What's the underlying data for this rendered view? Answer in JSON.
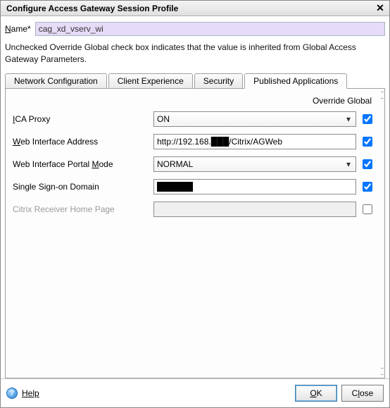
{
  "titlebar": {
    "title": "Configure Access Gateway Session Profile",
    "close_glyph": "✕"
  },
  "name_row": {
    "label_html": "Name*",
    "value": "cag_xd_vserv_wi"
  },
  "info_text": "Unchecked Override Global check box indicates that the value is inherited from Global Access Gateway Parameters.",
  "tabs": {
    "items": [
      {
        "label": "Network Configuration"
      },
      {
        "label": "Client Experience"
      },
      {
        "label": "Security"
      },
      {
        "label": "Published Applications"
      }
    ],
    "active_index": 3
  },
  "panel": {
    "override_header": "Override Global",
    "rows": [
      {
        "label": "ICA Proxy",
        "type": "select",
        "value": "ON",
        "checked": true,
        "disabled": false,
        "underline_idx": 0
      },
      {
        "label": "Web Interface Address",
        "type": "text",
        "value": "http://192.168.███/Citrix/AGWeb",
        "checked": true,
        "disabled": false,
        "underline_idx": 0
      },
      {
        "label": "Web Interface Portal Mode",
        "type": "select",
        "value": "NORMAL",
        "checked": true,
        "disabled": false,
        "underline_idx": 21
      },
      {
        "label": "Single Sign-on Domain",
        "type": "text",
        "value": "██████",
        "checked": true,
        "disabled": false,
        "underline_idx": -1
      },
      {
        "label": "Citrix Receiver Home Page",
        "type": "text",
        "value": "",
        "checked": false,
        "disabled": true,
        "underline_idx": -1
      }
    ]
  },
  "footer": {
    "help_label": "Help",
    "ok_label": "OK",
    "close_label": "Close"
  },
  "icons": {
    "dropdown_arrow": "▾"
  }
}
